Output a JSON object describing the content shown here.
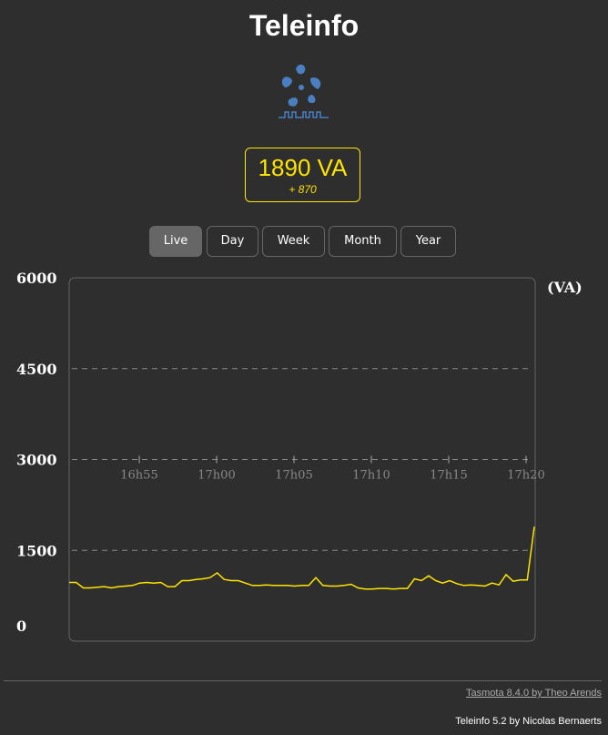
{
  "header": {
    "title": "Teleinfo"
  },
  "logo": {
    "icon": "teleinfo-fan-icon",
    "color": "#4a7fc1"
  },
  "power": {
    "value": "1890 VA",
    "delta": "+ 870",
    "color": "#ffe400"
  },
  "periods": [
    {
      "label": "Live",
      "active": true
    },
    {
      "label": "Day",
      "active": false
    },
    {
      "label": "Week",
      "active": false
    },
    {
      "label": "Month",
      "active": false
    },
    {
      "label": "Year",
      "active": false
    }
  ],
  "chart_data": {
    "type": "line",
    "unit_label": "(VA)",
    "ylim": [
      0,
      6000
    ],
    "y_ticks": [
      "6000",
      "4500",
      "3000",
      "1500",
      "0"
    ],
    "x_ticks": [
      "16h55",
      "17h00",
      "17h05",
      "17h10",
      "17h15",
      "17h20"
    ],
    "grid": "dashed horizontal at 1500, 3000, 4500",
    "line_color": "#ffe400",
    "series": [
      {
        "values": [
          970,
          970,
          880,
          880,
          890,
          900,
          880,
          900,
          910,
          920,
          960,
          970,
          960,
          970,
          900,
          900,
          1000,
          1000,
          1020,
          1030,
          1050,
          1130,
          1020,
          1000,
          1000,
          960,
          920,
          920,
          930,
          920,
          920,
          920,
          910,
          920,
          920,
          1050,
          920,
          910,
          910,
          920,
          940,
          880,
          860,
          860,
          870,
          870,
          860,
          870,
          870,
          1030,
          1000,
          1080,
          1000,
          960,
          1000,
          950,
          920,
          930,
          920,
          910,
          960,
          930,
          1100,
          990,
          1010,
          1010,
          1890
        ]
      }
    ]
  },
  "footer": {
    "tasmota_link": "Tasmota 8.4.0 by Theo Arends",
    "credit": "Teleinfo 5.2 by Nicolas Bernaerts"
  }
}
